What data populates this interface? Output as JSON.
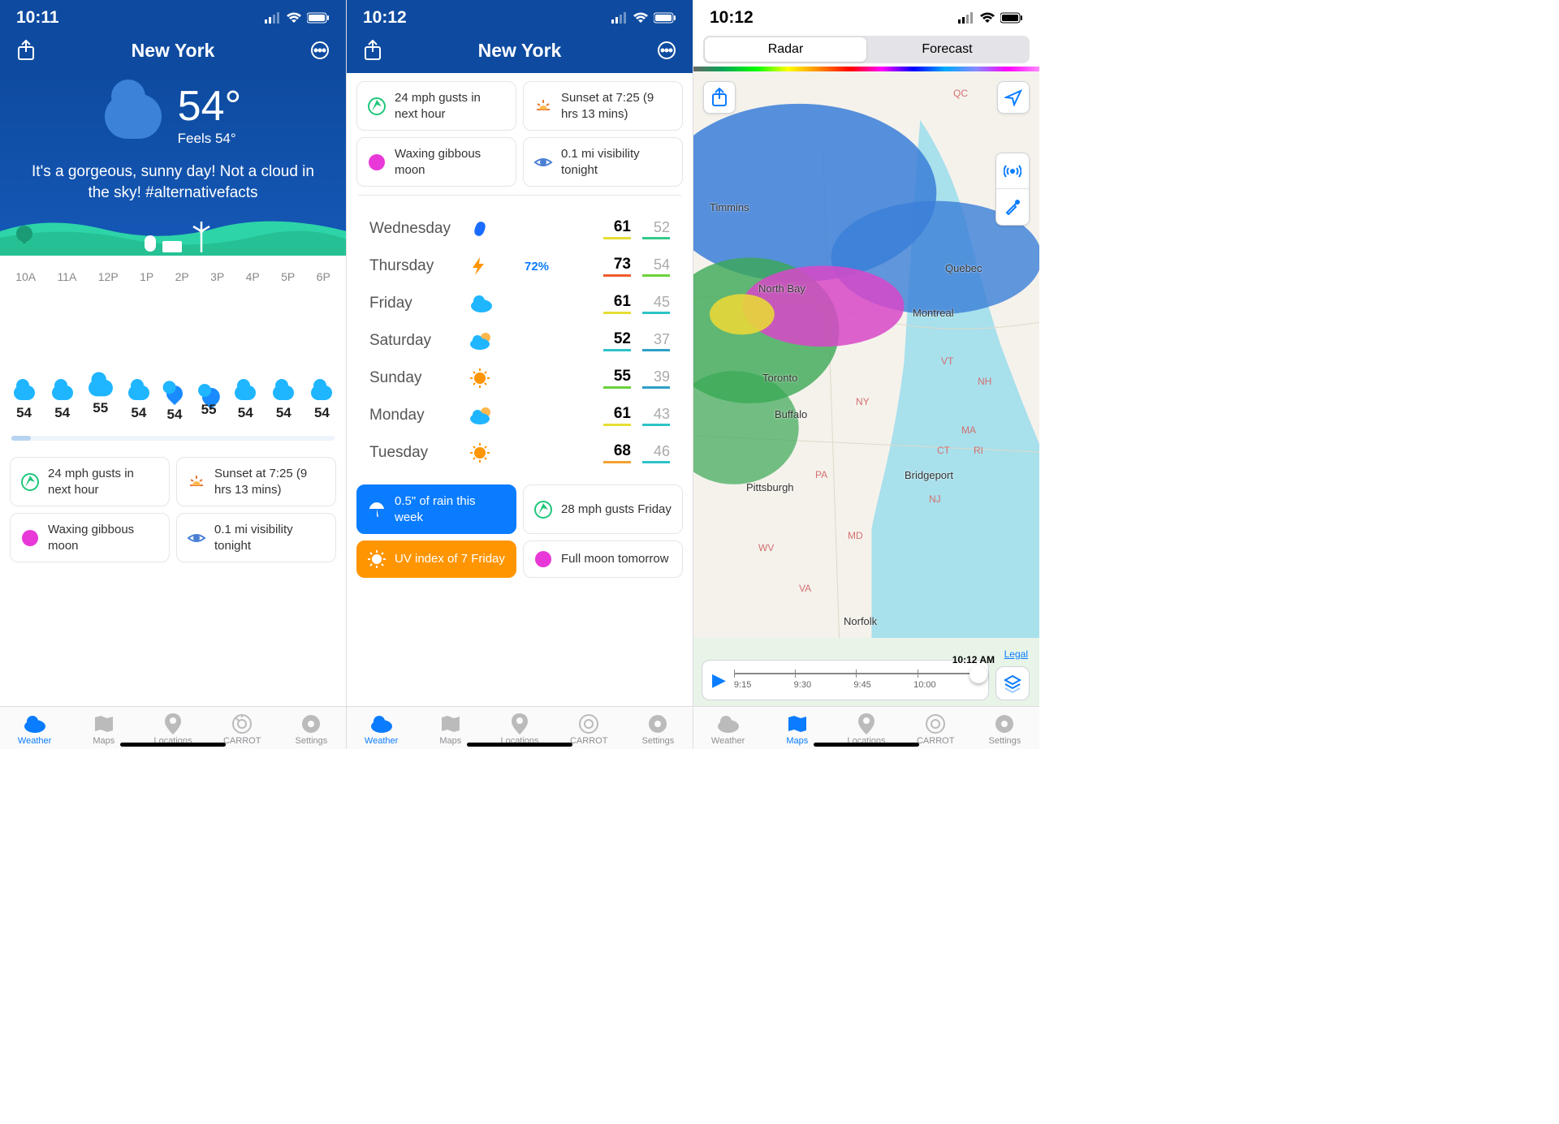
{
  "status_times": {
    "p1": "10:11",
    "p2": "10:12",
    "p3": "10:12"
  },
  "location": "New York",
  "hero": {
    "temp": "54°",
    "feels": "Feels 54°",
    "quote": "It's a gorgeous, sunny day! Not a cloud in the sky! #alternativefacts"
  },
  "hourly_times": [
    "10A",
    "11A",
    "12P",
    "1P",
    "2P",
    "3P",
    "4P",
    "5P",
    "6P"
  ],
  "hourly_temps": [
    "54",
    "54",
    "55",
    "54",
    "54",
    "55",
    "54",
    "54",
    "54"
  ],
  "info_cards": {
    "gusts": "24 mph gusts in next hour",
    "sunset": "Sunset at 7:25 (9 hrs 13 mins)",
    "moon": "Waxing gibbous moon",
    "visibility": "0.1 mi visibility tonight"
  },
  "daily": [
    {
      "day": "Wednesday",
      "icon": "rain",
      "precip": "",
      "hi": "61",
      "lo": "52",
      "hiColor": "#e6dd35",
      "loColor": "#35c98a"
    },
    {
      "day": "Thursday",
      "icon": "thunder",
      "precip": "72%",
      "hi": "73",
      "lo": "54",
      "hiColor": "#f15a2b",
      "loColor": "#6bd13a"
    },
    {
      "day": "Friday",
      "icon": "cloud",
      "precip": "",
      "hi": "61",
      "lo": "45",
      "hiColor": "#e6dd35",
      "loColor": "#2ec3c8"
    },
    {
      "day": "Saturday",
      "icon": "partly",
      "precip": "",
      "hi": "52",
      "lo": "37",
      "hiColor": "#2ec3c8",
      "loColor": "#2ea0c8"
    },
    {
      "day": "Sunday",
      "icon": "sun",
      "precip": "",
      "hi": "55",
      "lo": "39",
      "hiColor": "#6bd13a",
      "loColor": "#2ea0c8"
    },
    {
      "day": "Monday",
      "icon": "partly",
      "precip": "",
      "hi": "61",
      "lo": "43",
      "hiColor": "#e6dd35",
      "loColor": "#2ec3c8"
    },
    {
      "day": "Tuesday",
      "icon": "sun",
      "precip": "",
      "hi": "68",
      "lo": "46",
      "hiColor": "#f2a231",
      "loColor": "#2ec3c8"
    }
  ],
  "summary_cards": {
    "rain": "0.5\" of rain this week",
    "gusts2": "28 mph gusts Friday",
    "uv": "UV index of 7 Friday",
    "fullmoon": "Full moon tomorrow"
  },
  "tabs": [
    "Weather",
    "Maps",
    "Locations",
    "CARROT",
    "Settings"
  ],
  "segments": [
    "Radar",
    "Forecast"
  ],
  "map_cities": [
    "Timmins",
    "North Bay",
    "Quebec",
    "Montreal",
    "Toronto",
    "Buffalo",
    "Pittsburgh",
    "Bridgeport",
    "Norfolk"
  ],
  "map_states": [
    "QC",
    "VT",
    "NH",
    "NY",
    "MA",
    "CT",
    "RI",
    "PA",
    "NJ",
    "MD",
    "WV",
    "VA"
  ],
  "legal": "Legal",
  "timeline": {
    "now": "10:12 AM",
    "labels": [
      "9:15",
      "9:30",
      "9:45",
      "10:00"
    ]
  }
}
